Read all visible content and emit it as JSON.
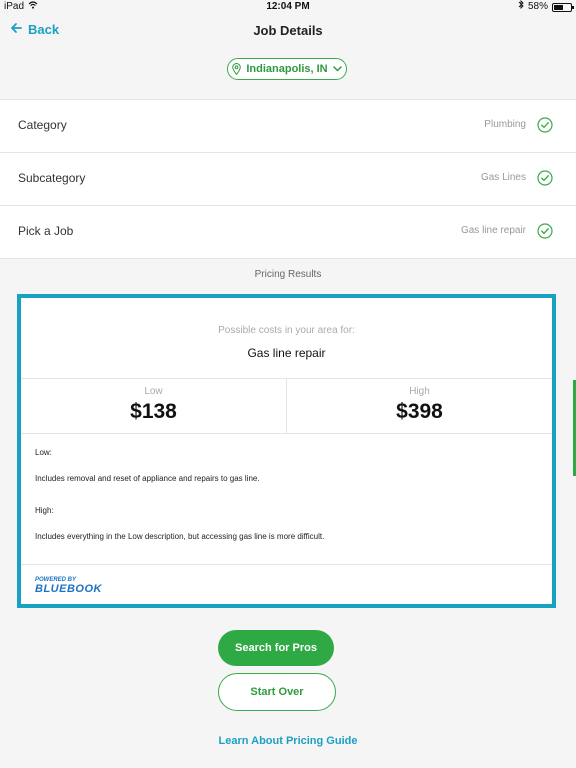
{
  "status_bar": {
    "device": "iPad",
    "time": "12:04 PM",
    "battery": "58%",
    "battery_level": 0.58
  },
  "nav": {
    "back_label": "Back",
    "title": "Job Details"
  },
  "location": {
    "label": "Indianapolis, IN"
  },
  "rows": [
    {
      "label": "Category",
      "value": "Plumbing"
    },
    {
      "label": "Subcategory",
      "value": "Gas Lines"
    },
    {
      "label": "Pick a Job",
      "value": "Gas line repair"
    }
  ],
  "pricing": {
    "section_title": "Pricing Results",
    "intro": "Possible costs in your area for:",
    "job": "Gas line repair",
    "low_label": "Low",
    "low_value": "$138",
    "high_label": "High",
    "high_value": "$398",
    "low_heading": "Low:",
    "low_description": "Includes removal and reset of appliance and repairs to gas line.",
    "high_heading": "High:",
    "high_description": "Includes everything in the Low description, but accessing gas line is more difficult.",
    "powered_by": "POWERED BY",
    "brand": "BLUEBOOK"
  },
  "actions": {
    "search_label": "Search for Pros",
    "start_over_label": "Start Over",
    "learn_label": "Learn About Pricing Guide"
  },
  "colors": {
    "accent_blue": "#17a2c0",
    "accent_green": "#2fa944",
    "brand_blue": "#1b73c6"
  }
}
